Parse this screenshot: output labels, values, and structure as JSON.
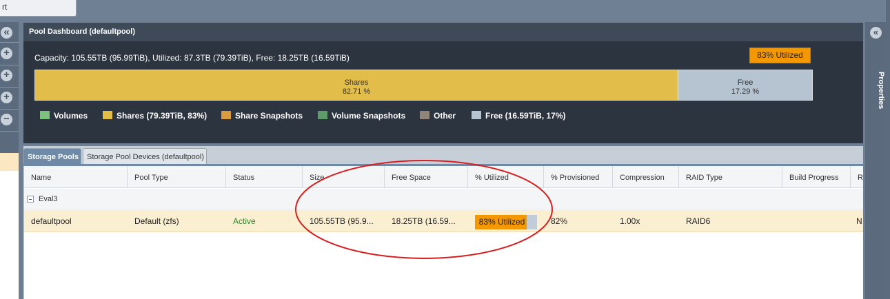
{
  "topbar": {
    "button_text": "rt"
  },
  "sidebar": {
    "buttons": [
      "«",
      "+",
      "+",
      "+",
      "−"
    ]
  },
  "properties_panel": {
    "label": "Properties",
    "collapse_icon": "«"
  },
  "dashboard": {
    "title": "Pool Dashboard (defaultpool)",
    "capacity_text": "Capacity: 105.55TB (95.99TiB), Utilized: 87.3TB (79.39TiB), Free: 18.25TB (16.59TiB)",
    "utilized_badge": "83% Utilized",
    "bar": {
      "shares": {
        "label": "Shares",
        "percent_text": "82.71 %",
        "fraction": 0.8271
      },
      "free": {
        "label": "Free",
        "percent_text": "17.29 %",
        "fraction": 0.1729
      }
    },
    "legend": [
      {
        "label": "Volumes",
        "color": "#7fbf7f"
      },
      {
        "label": "Shares (79.39TiB, 83%)",
        "color": "#e3bd4a"
      },
      {
        "label": "Share Snapshots",
        "color": "#d99a40"
      },
      {
        "label": "Volume Snapshots",
        "color": "#5e9a6a"
      },
      {
        "label": "Other",
        "color": "#8f8578"
      },
      {
        "label": "Free (16.59TiB, 17%)",
        "color": "#b6c3d0"
      }
    ]
  },
  "tabs": [
    {
      "label": "Storage Pools",
      "active": true
    },
    {
      "label": "Storage Pool Devices (defaultpool)",
      "active": false
    }
  ],
  "grid": {
    "columns": [
      "Name",
      "Pool Type",
      "Status",
      "Size",
      "Free Space",
      "% Utilized",
      "% Provisioned",
      "Compression",
      "RAID Type",
      "Build Progress",
      "R"
    ],
    "group": "Eval3",
    "row": {
      "name": "defaultpool",
      "pool_type": "Default (zfs)",
      "status": "Active",
      "size": "105.55TB (95.9...",
      "free_space": "18.25TB (16.59...",
      "utilized_text": "83% Utilized",
      "utilized_fraction": 0.83,
      "provisioned": "82%",
      "compression": "1.00x",
      "raid_type": "RAID6",
      "last": "N"
    }
  },
  "colors": {
    "accent_orange": "#f39800",
    "annotation_red": "#d81e1e"
  }
}
